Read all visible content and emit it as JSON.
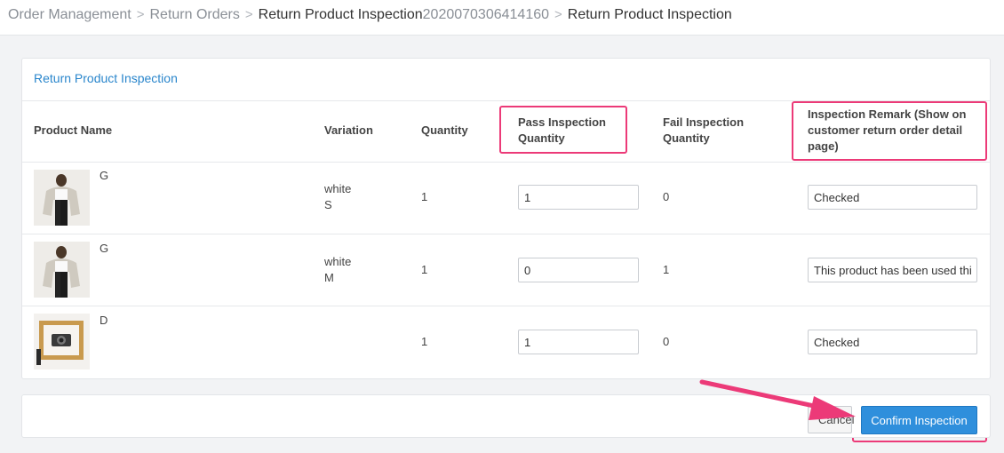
{
  "breadcrumb": {
    "items": [
      "Order Management",
      "Return Orders",
      "Return Product Inspection"
    ],
    "order_no": "2020070306414160",
    "current": "Return Product Inspection",
    "separator": ">"
  },
  "panel": {
    "title": "Return Product Inspection"
  },
  "table": {
    "headers": {
      "product": "Product Name",
      "variation": "Variation",
      "quantity": "Quantity",
      "pass": "Pass Inspection Quantity",
      "fail": "Fail Inspection Quantity",
      "remark": "Inspection Remark (Show on customer return order detail page)"
    },
    "rows": [
      {
        "name": "G",
        "variation_color": "white",
        "variation_size": "S",
        "quantity": "1",
        "pass": "1",
        "fail": "0",
        "remark": "Checked",
        "image": "woman-white-top-photo"
      },
      {
        "name": "G",
        "variation_color": "white",
        "variation_size": "M",
        "quantity": "1",
        "pass": "0",
        "fail": "1",
        "remark": "This product has been used thi",
        "image": "woman-white-top-photo"
      },
      {
        "name": "D",
        "variation_color": "",
        "variation_size": "",
        "quantity": "1",
        "pass": "1",
        "fail": "0",
        "remark": "Checked",
        "image": "camera-in-frame-photo"
      }
    ]
  },
  "actions": {
    "cancel": "Cancel",
    "confirm": "Confirm Inspection"
  },
  "colors": {
    "accent": "#2f8fdc",
    "highlight": "#ec3a78",
    "title": "#2a86cc"
  }
}
